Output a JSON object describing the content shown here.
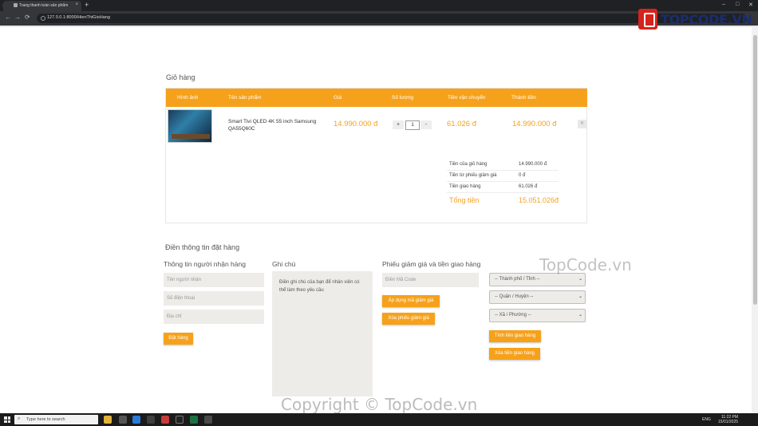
{
  "browser": {
    "tab_title": "Trang thanh toán sản phẩm",
    "tab_close": "×",
    "new_tab": "+",
    "url": "127.0.0.1:8000/HienThiGioHang"
  },
  "logo": {
    "text": "TOPCODE.VN"
  },
  "cart": {
    "title": "Giỏ hàng",
    "headers": {
      "image": "Hình ảnh",
      "name": "Tên sản phẩm",
      "price": "Giá",
      "quantity": "Số lượng",
      "shipping": "Tiền vận chuyển",
      "subtotal": "Thành tiền"
    },
    "item": {
      "name": "Smart Tivi QLED 4K 55 inch Samsung QA55Q60C",
      "price": "14.990.000 đ",
      "quantity": "1",
      "plus": "+",
      "minus": "-",
      "shipping": "61.026 đ",
      "subtotal": "14.990.000 đ",
      "remove": "✕"
    },
    "summary": {
      "cart_label": "Tiền của giỏ hàng",
      "cart_value": "14.990.000 đ",
      "voucher_label": "Tiền từ phiếu giảm giá",
      "voucher_value": "0 đ",
      "shipping_label": "Tiền giao hàng",
      "shipping_value": "61.026 đ",
      "total_label": "Tổng tiền",
      "total_value": "15.051.026đ"
    }
  },
  "order": {
    "title": "Điền thông tin đặt hàng",
    "recipient": {
      "title": "Thông tin người nhận hàng",
      "name_placeholder": "Tên người nhận",
      "phone_placeholder": "Số điện thoại",
      "address_placeholder": "Địa chỉ",
      "submit": "Đặt hàng"
    },
    "note": {
      "title": "Ghi chú",
      "placeholder": "Điền ghi chú của bạn để nhân viên có thể làm theo yêu cầu"
    },
    "voucher": {
      "title": "Phiếu giảm giá và tiền giao hàng",
      "code_placeholder": "Điền Mã Code",
      "apply": "Áp dụng mã giảm giá",
      "remove": "Xóa phiếu giảm giá"
    },
    "shipping": {
      "city": "-- Thành phố / Tỉnh --",
      "district": "-- Quận / Huyện --",
      "ward": "-- Xã / Phường --",
      "calc": "Tính tiền giao hàng",
      "remove": "Xóa tiền giao hàng"
    }
  },
  "watermarks": {
    "right": "TopCode.vn",
    "bottom": "Copyright © TopCode.vn"
  },
  "taskbar": {
    "search_placeholder": "Type here to search",
    "time": "11:22 PM",
    "date": "15/01/2025",
    "lang": "ENG"
  },
  "colors": {
    "accent": "#f6a11b",
    "field_bg": "#eeece8",
    "logo_red": "#d6231c",
    "logo_blue": "#1a2e6d"
  }
}
